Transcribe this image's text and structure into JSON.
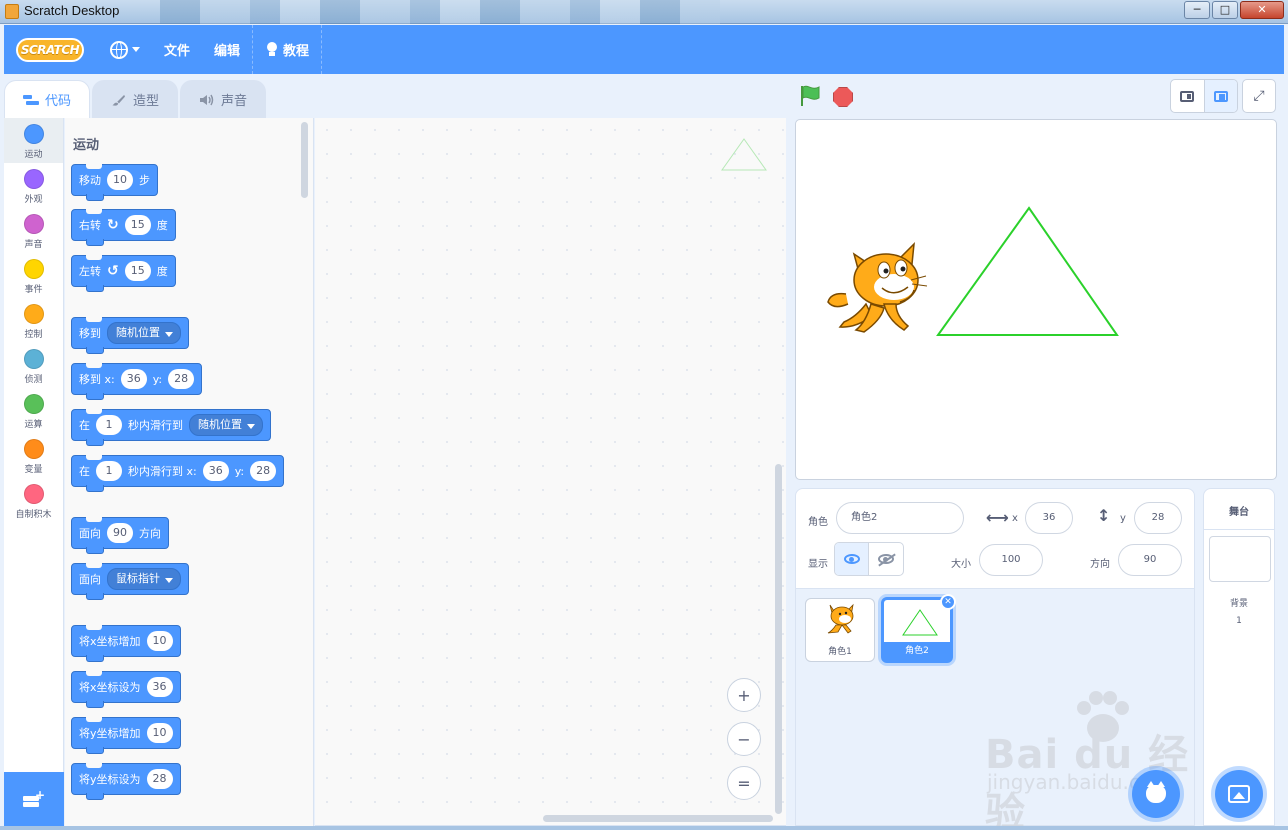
{
  "window": {
    "title": "Scratch Desktop",
    "controls": [
      "─",
      "□",
      "✕"
    ]
  },
  "menubar": {
    "logo": "SCRATCH",
    "file": "文件",
    "edit": "编辑",
    "tutorials": "教程"
  },
  "tabs": {
    "code": "代码",
    "costumes": "造型",
    "sounds": "声音"
  },
  "categories": [
    {
      "label": "运动",
      "color": "#4c97ff"
    },
    {
      "label": "外观",
      "color": "#9966ff"
    },
    {
      "label": "声音",
      "color": "#cf63cf"
    },
    {
      "label": "事件",
      "color": "#ffd500"
    },
    {
      "label": "控制",
      "color": "#ffab19"
    },
    {
      "label": "侦测",
      "color": "#5cb1d6"
    },
    {
      "label": "运算",
      "color": "#59c059"
    },
    {
      "label": "变量",
      "color": "#ff8c1a"
    },
    {
      "label": "自制积木",
      "color": "#ff6680"
    }
  ],
  "palette": {
    "title": "运动",
    "b_move": {
      "label": "移动",
      "value": "10",
      "suffix": "步"
    },
    "b_turn_right": {
      "label": "右转",
      "value": "15",
      "suffix": "度"
    },
    "b_turn_left": {
      "label": "左转",
      "value": "15",
      "suffix": "度"
    },
    "b_goto": {
      "label": "移到",
      "option": "随机位置"
    },
    "b_goto_xy": {
      "label": "移到 x:",
      "x": "36",
      "ylabel": "y:",
      "y": "28"
    },
    "b_glide": {
      "label": "在",
      "secs": "1",
      "mid": "秒内滑行到",
      "option": "随机位置"
    },
    "b_glide_xy": {
      "label": "在",
      "secs": "1",
      "mid": "秒内滑行到 x:",
      "x": "36",
      "ylabel": "y:",
      "y": "28"
    },
    "b_point_dir": {
      "label": "面向",
      "value": "90",
      "suffix": "方向"
    },
    "b_point_towards": {
      "label": "面向",
      "option": "鼠标指针"
    },
    "b_change_x": {
      "label": "将x坐标增加",
      "value": "10"
    },
    "b_set_x": {
      "label": "将x坐标设为",
      "value": "36"
    },
    "b_change_y": {
      "label": "将y坐标增加",
      "value": "10"
    },
    "b_set_y": {
      "label": "将y坐标设为",
      "value": "28"
    }
  },
  "zoom": {
    "in": "+",
    "out": "−",
    "reset": "="
  },
  "sprite_info": {
    "sprite_label": "角色",
    "sprite_name": "角色2",
    "x_label": "x",
    "x": "36",
    "y_label": "y",
    "y": "28",
    "show_label": "显示",
    "size_label": "大小",
    "size": "100",
    "direction_label": "方向",
    "direction": "90"
  },
  "sprites": [
    {
      "name": "角色1"
    },
    {
      "name": "角色2"
    }
  ],
  "stage_panel": {
    "title": "舞台",
    "backdrops_label": "背景",
    "backdrops_count": "1"
  },
  "watermark": {
    "main": "Bai  du 经验",
    "sub": "jingyan.baidu.com"
  },
  "colors": {
    "accent": "#4c97ff",
    "flag": "#4cbf56",
    "stop": "#ec5959",
    "triangle": "#2bd12b"
  }
}
